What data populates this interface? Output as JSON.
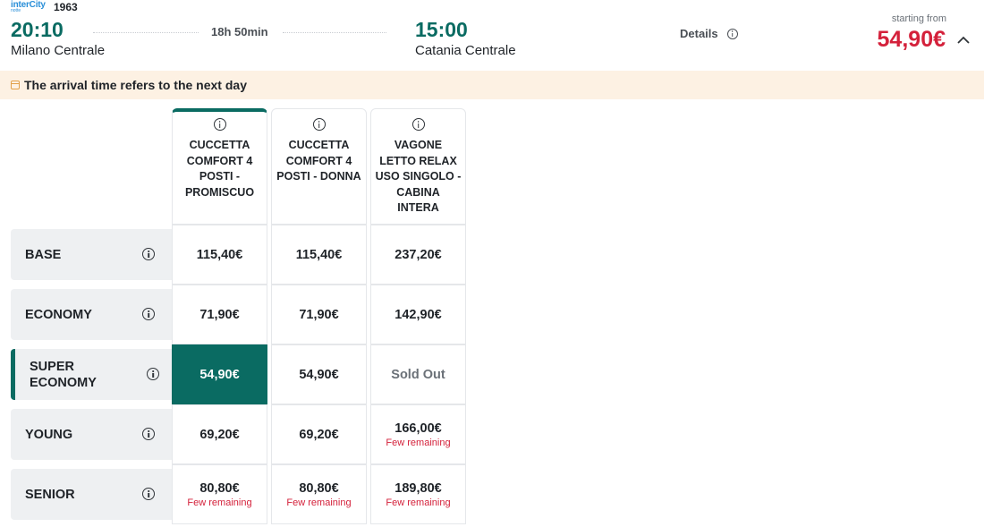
{
  "train": {
    "brand_line1": "interCity",
    "brand_line2": "notte",
    "number": "1963",
    "departure_time": "20:10",
    "departure_station": "Milano Centrale",
    "duration": "18h 50min",
    "arrival_time": "15:00",
    "arrival_station": "Catania Centrale",
    "details_label": "Details",
    "starting_from_label": "starting from",
    "starting_price": "54,90€"
  },
  "notice": {
    "text": "The arrival time refers to the next day"
  },
  "columns": [
    {
      "title": "CUCCETTA COMFORT 4 POSTI - PROMISCUO",
      "active": true
    },
    {
      "title": "CUCCETTA COMFORT 4 POSTI - DONNA",
      "active": false
    },
    {
      "title": "VAGONE LETTO RELAX USO SINGOLO - CABINA INTERA",
      "active": false
    }
  ],
  "rows": [
    {
      "label": "BASE",
      "active": false,
      "cells": [
        {
          "price": "115,40€",
          "note": ""
        },
        {
          "price": "115,40€",
          "note": ""
        },
        {
          "price": "237,20€",
          "note": ""
        }
      ]
    },
    {
      "label": "ECONOMY",
      "active": false,
      "cells": [
        {
          "price": "71,90€",
          "note": ""
        },
        {
          "price": "71,90€",
          "note": ""
        },
        {
          "price": "142,90€",
          "note": ""
        }
      ]
    },
    {
      "label": "SUPER ECONOMY",
      "active": true,
      "cells": [
        {
          "price": "54,90€",
          "note": "",
          "selected": true
        },
        {
          "price": "54,90€",
          "note": ""
        },
        {
          "price": "Sold Out",
          "note": "",
          "soldout": true
        }
      ]
    },
    {
      "label": "YOUNG",
      "active": false,
      "cells": [
        {
          "price": "69,20€",
          "note": ""
        },
        {
          "price": "69,20€",
          "note": ""
        },
        {
          "price": "166,00€",
          "note": "Few remaining"
        }
      ]
    },
    {
      "label": "SENIOR",
      "active": false,
      "cells": [
        {
          "price": "80,80€",
          "note": "Few remaining"
        },
        {
          "price": "80,80€",
          "note": "Few remaining"
        },
        {
          "price": "189,80€",
          "note": "Few remaining"
        }
      ]
    }
  ],
  "colors": {
    "accent": "#0a6b62",
    "price_red": "#d4213b",
    "notice_bg": "#fdf1e3"
  },
  "icons": {
    "info": "info-icon",
    "chevron": "chevron-up-icon",
    "calendar": "calendar-icon"
  }
}
